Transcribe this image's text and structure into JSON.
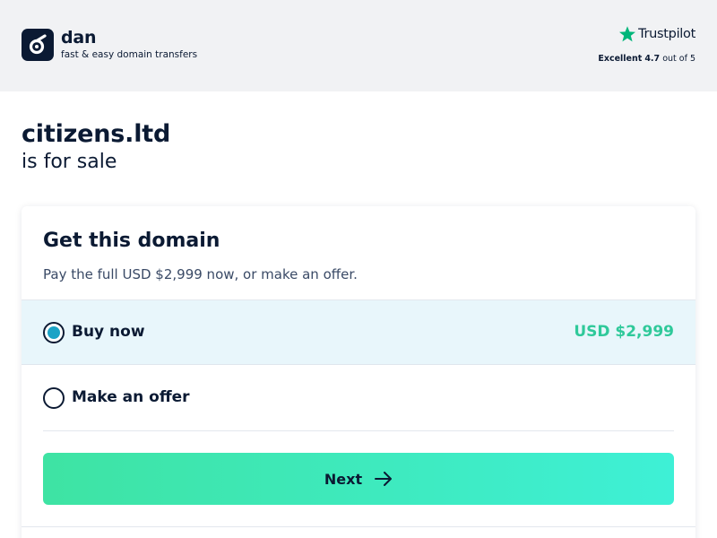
{
  "header": {
    "brand_name": "dan",
    "brand_tagline": "fast & easy domain transfers",
    "trustpilot": {
      "name": "Trustpilot",
      "rating_word": "Excellent",
      "rating_value": "4.7",
      "rating_suffix": "out of 5",
      "star_color": "#00b67a"
    }
  },
  "main": {
    "domain": "citizens.ltd",
    "status": "is for sale"
  },
  "card": {
    "title": "Get this domain",
    "subtitle": "Pay the full USD $2,999 now, or make an offer.",
    "options": [
      {
        "label": "Buy now",
        "price": "USD $2,999",
        "selected": true
      },
      {
        "label": "Make an offer",
        "selected": false
      }
    ],
    "next_label": "Next"
  },
  "colors": {
    "brand_dark": "#0b1a33",
    "price_green": "#2fc99a",
    "selected_bg": "#e8f6fb",
    "radio_accent": "#1ba3c6",
    "button_gradient_start": "#3ee3a3",
    "button_gradient_end": "#3ef0d6"
  },
  "icons": {
    "logo": "dan-logo-icon",
    "trustpilot_star": "star-icon",
    "next_arrow": "arrow-right-icon"
  }
}
